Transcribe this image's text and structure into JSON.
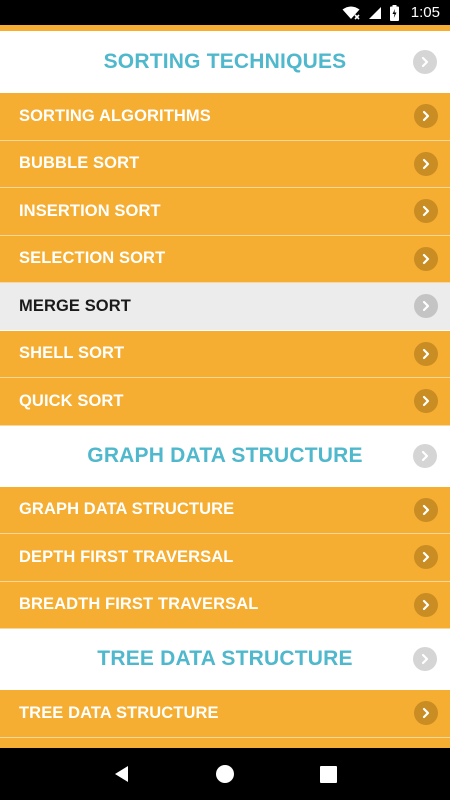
{
  "status_bar": {
    "time": "1:05",
    "icons": [
      "wifi-icon",
      "signal-icon",
      "battery-icon"
    ]
  },
  "colors": {
    "accent": "#f5ae31",
    "header_text": "#4fb8cc",
    "selected_row": "#ececec"
  },
  "sections": [
    {
      "title": "SORTING TECHNIQUES",
      "items": [
        {
          "label": "SORTING ALGORITHMS"
        },
        {
          "label": "BUBBLE SORT"
        },
        {
          "label": "INSERTION SORT"
        },
        {
          "label": "SELECTION SORT"
        },
        {
          "label": "MERGE SORT"
        },
        {
          "label": "SHELL SORT"
        },
        {
          "label": "QUICK SORT"
        }
      ]
    },
    {
      "title": "GRAPH DATA STRUCTURE",
      "items": [
        {
          "label": "GRAPH DATA STRUCTURE"
        },
        {
          "label": "DEPTH FIRST TRAVERSAL"
        },
        {
          "label": "BREADTH FIRST TRAVERSAL"
        }
      ]
    },
    {
      "title": "TREE DATA STRUCTURE",
      "items": [
        {
          "label": "TREE DATA STRUCTURE"
        }
      ]
    }
  ],
  "nav_bar": {
    "buttons": [
      "back-icon",
      "home-icon",
      "recents-icon"
    ]
  }
}
